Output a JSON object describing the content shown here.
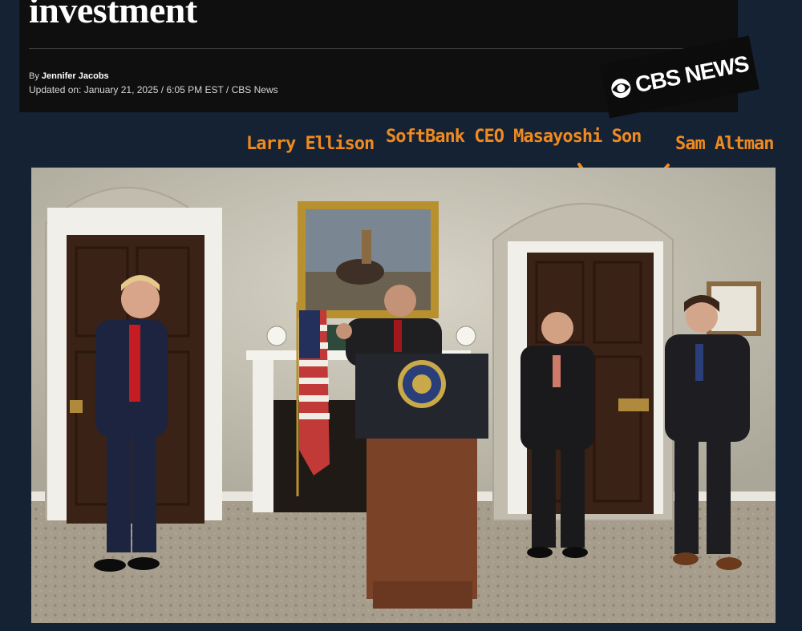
{
  "article": {
    "headline": "investment",
    "byline_prefix": "By",
    "author": "Jennifer Jacobs",
    "updated": "Updated on: January 21, 2025 / 6:05 PM EST / CBS News"
  },
  "logo": {
    "text": "CBS NEWS"
  },
  "annotations": {
    "larry": "Larry Ellison",
    "son": "SoftBank CEO Masayoshi Son",
    "altman": "Sam Altman",
    "color": "#f08a1f"
  },
  "photo": {
    "colors": {
      "wall": "#c9c5b8",
      "door": "#3b2216",
      "carpet": "#a49b8a",
      "podium": "#7a4226",
      "suit": "#1c2233"
    }
  }
}
